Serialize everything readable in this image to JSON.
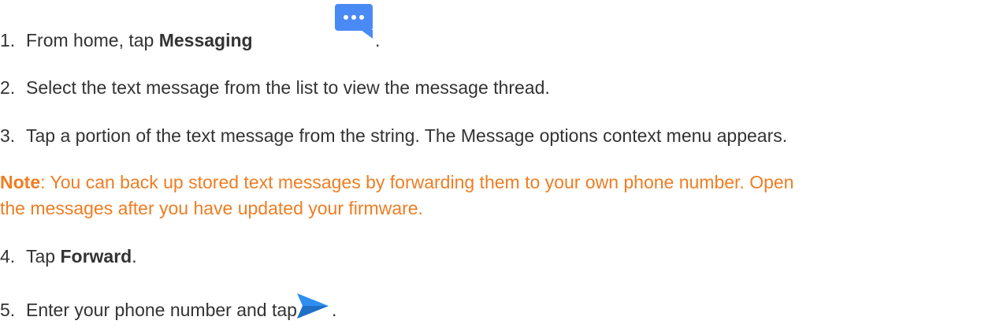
{
  "steps": [
    {
      "num": "1.",
      "pre": "From home, tap ",
      "bold": "Messaging",
      "post": "."
    },
    {
      "num": "2.",
      "text": "Select the text message from the list to view the message thread."
    },
    {
      "num": "3.",
      "text": "Tap a portion of the text message from the string. The Message options context menu appears."
    },
    {
      "num": "4.",
      "pre": "Tap ",
      "bold": "Forward",
      "post": "."
    },
    {
      "num": "5.",
      "pre": "Enter your phone number and tap ",
      "post": "."
    }
  ],
  "note": {
    "label": "Note",
    "text": ": You can back up stored text messages by forwarding them to your own phone number. Open",
    "text2": "the messages after you have updated your firmware."
  },
  "icons": {
    "messaging": "messaging-app-icon",
    "send": "send-arrow-icon"
  },
  "colors": {
    "text": "#333333",
    "note": "#ef7d22",
    "messaging_icon": "#4a8af4",
    "send_icon": "#2f8ff0"
  }
}
